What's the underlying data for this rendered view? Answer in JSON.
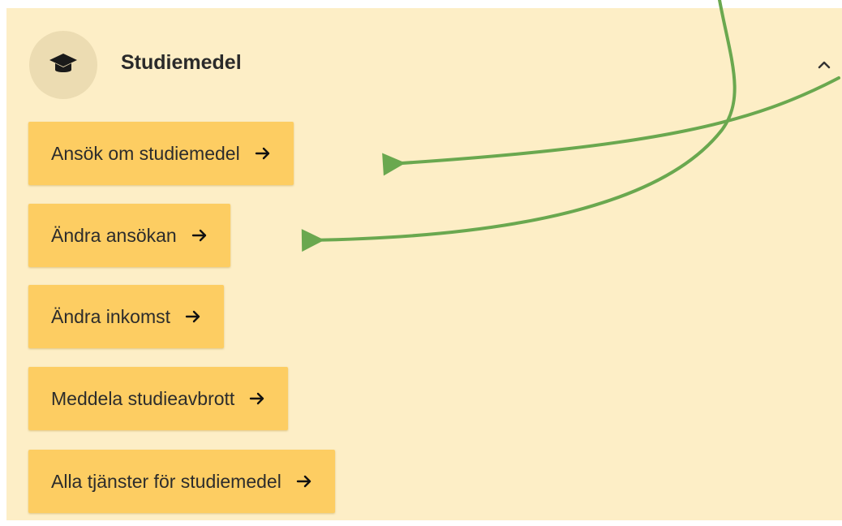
{
  "section": {
    "title": "Studiemedel",
    "icon": "graduation-cap-icon",
    "toggle_icon": "chevron-up-icon",
    "expanded": true
  },
  "links": [
    {
      "label": "Ansök om studiemedel",
      "icon": "arrow-right-icon"
    },
    {
      "label": "Ändra ansökan",
      "icon": "arrow-right-icon"
    },
    {
      "label": "Ändra inkomst",
      "icon": "arrow-right-icon"
    },
    {
      "label": "Meddela studieavbrott",
      "icon": "arrow-right-icon"
    },
    {
      "label": "Alla tjänster för studiemedel",
      "icon": "arrow-right-icon"
    }
  ],
  "annotations": {
    "arrow_color": "#6aa84f",
    "count": 2
  },
  "colors": {
    "panel_background": "#fdeec6",
    "button_background": "#fdcd62",
    "icon_circle": "#ecdcb2",
    "text": "#2c2c2c"
  }
}
